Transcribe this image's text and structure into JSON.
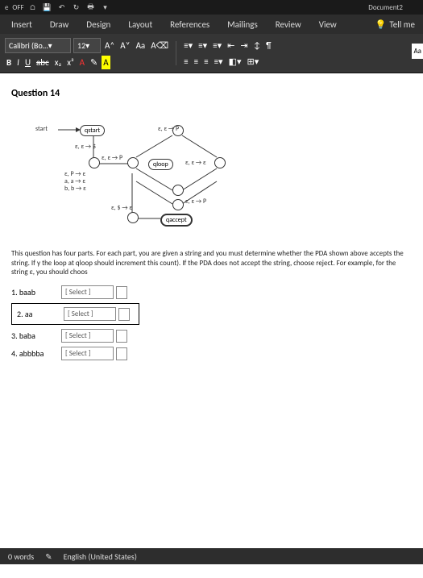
{
  "titlebar": {
    "off": "OFF",
    "doc": "Document2"
  },
  "tabs": [
    "Insert",
    "Draw",
    "Design",
    "Layout",
    "References",
    "Mailings",
    "Review",
    "View"
  ],
  "tellme": "Tell me",
  "ribbon": {
    "font": "Calibri (Bo…",
    "size": "12",
    "A_inc": "A˄",
    "A_dec": "A˅",
    "Aa": "Aa",
    "clear": "A⌫",
    "B": "B",
    "I": "I",
    "U": "U",
    "strike": "abc",
    "sub": "x₂",
    "sup": "x²",
    "Acol": "A",
    "pen": "✎",
    "Ahl": "A",
    "aa_side": "Aa"
  },
  "question": {
    "title": "Question 14",
    "start": "start",
    "qstart": "qstart",
    "qloop": "qloop",
    "qaccept": "qaccept",
    "t_eeS": "ε, ε → $",
    "t_eeP": "ε, ε → P",
    "t_eSe": "ε, $ → ε",
    "trans": [
      "ε, P → ε",
      "a, a → ε",
      "b, b → ε"
    ],
    "text": "This question has four parts. For each part, you are given a string and you must determine whether the PDA shown above accepts the string. If y the loop at qloop should increment this count). If the PDA does not accept the string, choose reject. For example, for the string ε, you should choos",
    "items": [
      "1. baab",
      "2. aa",
      "3. baba",
      "4. abbbba"
    ],
    "select": "[ Select ]"
  },
  "status": {
    "words": "0 words",
    "lang": "English (United States)"
  }
}
